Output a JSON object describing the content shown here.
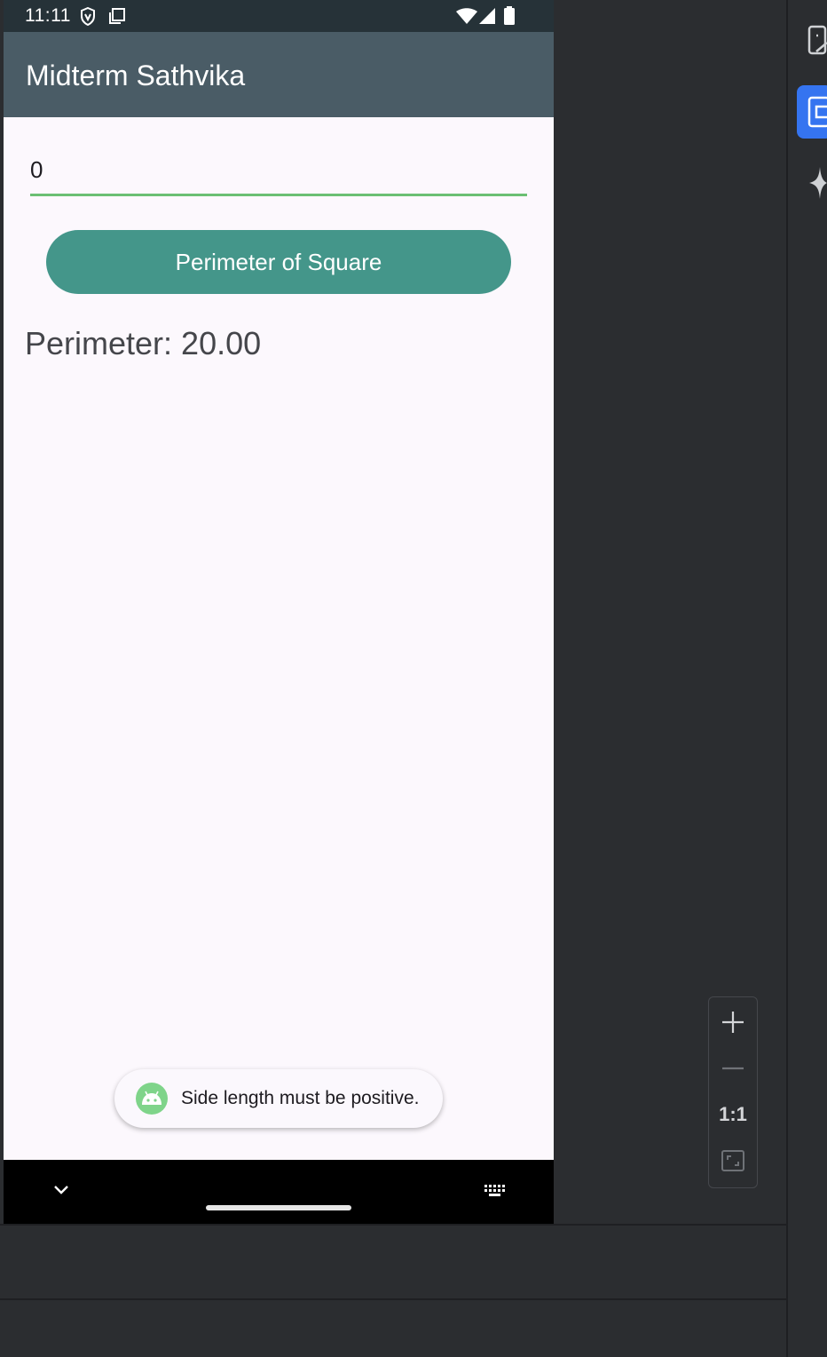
{
  "status_bar": {
    "time": "11:11"
  },
  "app": {
    "title": "Midterm Sathvika"
  },
  "form": {
    "side_input_value": "0",
    "button_label": "Perimeter of Square",
    "result_text": "Perimeter: 20.00"
  },
  "toast": {
    "message": "Side length must be positive."
  },
  "zoom_controls": {
    "ratio_label": "1:1"
  },
  "colors": {
    "app_bar": "#4a5c66",
    "status_bar": "#263238",
    "button": "#44968a",
    "input_underline": "#6bbf73",
    "ide_background": "#2b2d30",
    "ide_accent": "#3574f0"
  },
  "icons": {
    "status": [
      "vpn-shield-icon",
      "screen-copy-icon",
      "wifi-icon",
      "signal-icon",
      "battery-icon"
    ],
    "nav": [
      "collapse-chevron-icon",
      "keyboard-icon"
    ],
    "zoom": [
      "zoom-in-icon",
      "zoom-out-icon",
      "fit-screen-icon"
    ],
    "ide_side": [
      "device-mirror-icon",
      "running-devices-icon",
      "gemini-sparkle-icon"
    ]
  }
}
